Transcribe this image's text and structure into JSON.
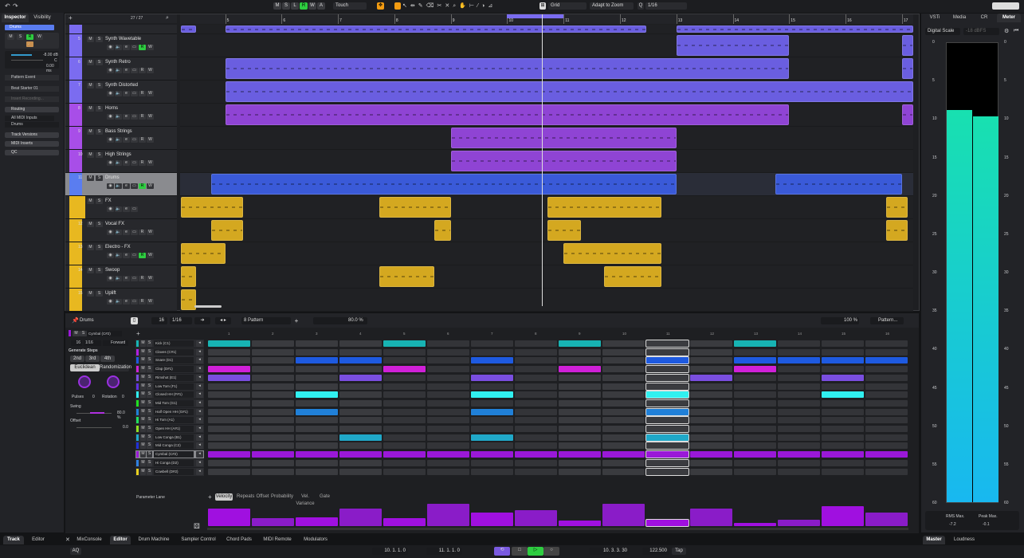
{
  "toolbar": {
    "mode_buttons": [
      "M",
      "S",
      "L",
      "R",
      "W",
      "A"
    ],
    "automation_mode": "Touch",
    "snap_type": "Grid",
    "grid_mode": "Adapt to Zoom",
    "quantize": "1/16",
    "accent_color": "#f39c12",
    "record_color": "#2ecc40"
  },
  "inspector": {
    "tabs": [
      "Inspector",
      "Visibility"
    ],
    "track_name": "Drums",
    "volume": "-8.00 dB",
    "pan": "C",
    "delay": "0.00 ms",
    "pattern_type": "Pattern Event",
    "preset": "Beat Starter 01",
    "insert_placeholder": "Insert Recording...",
    "sections": [
      "Routing",
      "Track Versions",
      "MIDI Inserts",
      "QC"
    ],
    "input": "All MIDI Inputs",
    "output": "Drums"
  },
  "project": {
    "track_count": "27 / 27",
    "ruler_range": [
      4.2,
      17.2
    ],
    "ruler_labels": [
      "5",
      "6",
      "7",
      "8",
      "9",
      "10",
      "11",
      "12",
      "13",
      "14",
      "15",
      "16",
      "17"
    ],
    "locators": [
      10,
      11
    ],
    "playhead_bar": 10.62,
    "tracks": [
      {
        "num": "",
        "name": "",
        "color": "#7b6cf0",
        "clipcolor": "#6a5ee0",
        "clips": [
          [
            4.21,
            4.48
          ],
          [
            5,
            12.46
          ],
          [
            13,
            17.2
          ]
        ],
        "partial": true
      },
      {
        "num": "5",
        "name": "Synth Wavetable",
        "color": "#7b6cf0",
        "clipcolor": "#6a5ee0",
        "clips": [
          [
            13,
            15
          ],
          [
            17,
            17.2
          ]
        ],
        "rec": true
      },
      {
        "num": "6",
        "name": "Synth Retro",
        "color": "#7b6cf0",
        "clipcolor": "#6a5ee0",
        "clips": [
          [
            5,
            15
          ],
          [
            17,
            17.2
          ]
        ]
      },
      {
        "num": "7",
        "name": "Synth Distorted",
        "color": "#7b6cf0",
        "clipcolor": "#6a5ee0",
        "clips": [
          [
            5,
            17.2
          ]
        ]
      },
      {
        "num": "8",
        "name": "Horns",
        "color": "#a84ee8",
        "clipcolor": "#8f44d4",
        "clips": [
          [
            5,
            15
          ],
          [
            17,
            17.2
          ]
        ]
      },
      {
        "num": "9",
        "name": "Bass Strings",
        "color": "#a84ee8",
        "clipcolor": "#8f44d4",
        "clips": [
          [
            9,
            13
          ]
        ]
      },
      {
        "num": "10",
        "name": "High Strings",
        "color": "#a84ee8",
        "clipcolor": "#8f44d4",
        "clips": [
          [
            9,
            13
          ]
        ]
      },
      {
        "num": "11",
        "name": "Drums",
        "color": "#5a7df0",
        "clipcolor": "#3a5ad8",
        "clips": [
          [
            4.75,
            13
          ],
          [
            14.75,
            17
          ]
        ],
        "selected": true,
        "rec": true
      },
      {
        "num": "",
        "name": "FX",
        "color": "#e8b820",
        "clipcolor": "#d4a820",
        "clips": [
          [
            4.21,
            5.32
          ],
          [
            7.73,
            9
          ],
          [
            10.72,
            12.73
          ],
          [
            16.72,
            17.1
          ]
        ],
        "folder": true
      },
      {
        "num": "12",
        "name": "Vocal FX",
        "color": "#e8b820",
        "clipcolor": "#d4a820",
        "clips": [
          [
            4.75,
            5.32
          ],
          [
            8.71,
            9
          ],
          [
            10.72,
            11.31
          ],
          [
            16.72,
            17.1
          ]
        ]
      },
      {
        "num": "13",
        "name": "Electro - FX",
        "color": "#e8b820",
        "clipcolor": "#d4a820",
        "clips": [
          [
            4.21,
            5
          ],
          [
            11,
            12.73
          ]
        ],
        "rec": true
      },
      {
        "num": "14",
        "name": "Swoop",
        "color": "#e8b820",
        "clipcolor": "#d4a820",
        "clips": [
          [
            4.21,
            4.48
          ],
          [
            7.73,
            8.71
          ],
          [
            11.72,
            12.73
          ]
        ]
      },
      {
        "num": "15",
        "name": "Uplift",
        "color": "#e8b820",
        "clipcolor": "#d4a820",
        "clips": [
          [
            4.21,
            4.48
          ]
        ]
      }
    ]
  },
  "drum_editor": {
    "title": "Drums",
    "steps": "16",
    "resolution": "1/16",
    "pattern": "8 Pattern",
    "swing_readout": "80.0 %",
    "zoom": "100 %",
    "pattern_menu": "Pattern...",
    "selected_lane": "Cymbal (C#2)",
    "direction": "Forward",
    "generate_steps_label": "Generate Steps",
    "gen_buttons": [
      "2nd",
      "3rd",
      "4th"
    ],
    "gen_tabs": [
      "Euclidean",
      "Randomization"
    ],
    "pulses_label": "Pulses",
    "pulses": "0",
    "rotation_label": "Rotation",
    "rotation": "0",
    "swing_label": "Swing",
    "swing": 80.0,
    "swing_value": "80.0 %",
    "offset_label": "Offset",
    "offset_value": "0.0",
    "selected_step": 11,
    "step_labels": [
      "1",
      "2",
      "3",
      "4",
      "5",
      "6",
      "7",
      "8",
      "9",
      "10",
      "11",
      "12",
      "13",
      "14",
      "15",
      "16"
    ],
    "rows": [
      {
        "name": "Kick (C1)",
        "color": "#17b3b3",
        "steps": [
          1,
          5,
          9,
          13
        ]
      },
      {
        "name": "Claves (C#1)",
        "color": "#b020e0",
        "steps": []
      },
      {
        "name": "Snare (D1)",
        "color": "#1e5ae0",
        "steps": [
          3,
          4,
          7,
          11,
          13,
          14,
          15,
          16
        ]
      },
      {
        "name": "Clap (D#1)",
        "color": "#d020d8",
        "steps": [
          1,
          5,
          9,
          13
        ]
      },
      {
        "name": "Rimshot (E1)",
        "color": "#7a4ee0",
        "steps": [
          1,
          4,
          7,
          12,
          15
        ]
      },
      {
        "name": "Low Tom (F1)",
        "color": "#6030e0",
        "steps": []
      },
      {
        "name": "Closed HH (F#1)",
        "color": "#30f0f0",
        "steps": [
          3,
          7,
          11,
          15
        ]
      },
      {
        "name": "Mid Tom (G1)",
        "color": "#20e020",
        "steps": []
      },
      {
        "name": "Half Open HH (G#1)",
        "color": "#2080d8",
        "steps": [
          3,
          7,
          11
        ]
      },
      {
        "name": "Hi Tom (A1)",
        "color": "#20e060",
        "steps": []
      },
      {
        "name": "Open HH (A#1)",
        "color": "#90e020",
        "steps": []
      },
      {
        "name": "Low Conga (B1)",
        "color": "#20a8c8",
        "steps": [
          4,
          7,
          11
        ]
      },
      {
        "name": "Mid Conga (C2)",
        "color": "#2030d8",
        "steps": []
      },
      {
        "name": "Cymbal (C#2)",
        "color": "#9a18d8",
        "steps": [
          1,
          2,
          3,
          4,
          5,
          6,
          7,
          8,
          9,
          10,
          11,
          12,
          13,
          14,
          15,
          16
        ],
        "selected": true
      },
      {
        "name": "Hi Conga (D2)",
        "color": "#3080e0",
        "steps": []
      },
      {
        "name": "Cowbell (D#2)",
        "color": "#e8d020",
        "steps": []
      }
    ],
    "parameter_lane_label": "Parameter Lane",
    "param_tabs": [
      "Velocity",
      "Repeats",
      "Offset",
      "Probability",
      "Vel. Variance",
      "Gate"
    ],
    "velocity": [
      0.8,
      0.35,
      0.4,
      0.8,
      0.35,
      1.0,
      0.6,
      0.7,
      0.25,
      1.0,
      0.3,
      0.8,
      0.15,
      0.3,
      0.9,
      0.6
    ]
  },
  "right_zone": {
    "tabs": [
      "VSTi",
      "Media",
      "CR",
      "Meter"
    ],
    "scale": "Digital Scale",
    "reference": "-18 dBFS",
    "scale_labels": [
      "0",
      "5",
      "10",
      "15",
      "20",
      "25",
      "30",
      "35",
      "40",
      "45",
      "50",
      "55",
      "60"
    ],
    "level_left_db": -8.9,
    "level_right_db": -9.8,
    "rms_label": "RMS Max.",
    "rms_value": "-7.2",
    "peak_label": "Peak Max.",
    "peak_value": "-0.1",
    "bottom_tabs": [
      "Master",
      "Loudness"
    ]
  },
  "bottom_tabs": [
    "Track",
    "Editor",
    "MixConsole",
    "Editor",
    "Drum Machine",
    "Sampler Control",
    "Chord Pads",
    "MIDI Remote",
    "Modulators"
  ],
  "transport": {
    "aq": "AQ",
    "left_locator": "10. 1. 1.   0",
    "right_locator": "11. 1. 1.   0",
    "position": "10. 3. 3. 30",
    "tempo": "122.500",
    "tap": "Tap"
  }
}
